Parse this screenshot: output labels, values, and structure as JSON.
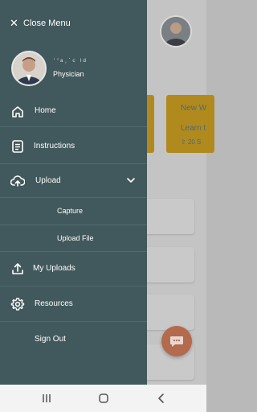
{
  "background": {
    "card_title": "New W",
    "card_subtitle": "Learn t",
    "card_meta": "20 S"
  },
  "drawer": {
    "close_label": "Close Menu",
    "user_name": "ˈ’ᵃ˒˙ᶜ ˡᵈ",
    "user_role": "Physician",
    "items": [
      {
        "label": "Home",
        "icon": "home-icon"
      },
      {
        "label": "Instructions",
        "icon": "document-icon"
      },
      {
        "label": "Upload",
        "icon": "cloud-upload-icon"
      },
      {
        "label": "My Uploads",
        "icon": "upload-arrow-icon"
      },
      {
        "label": "Resources",
        "icon": "gear-icon"
      },
      {
        "label": "Sign Out",
        "icon": ""
      }
    ],
    "upload_subitems": [
      {
        "label": "Capture"
      },
      {
        "label": "Upload File"
      }
    ]
  },
  "colors": {
    "drawer_bg": "#41585c",
    "accent_card": "#b18a1e",
    "fab": "#b46a4c"
  }
}
